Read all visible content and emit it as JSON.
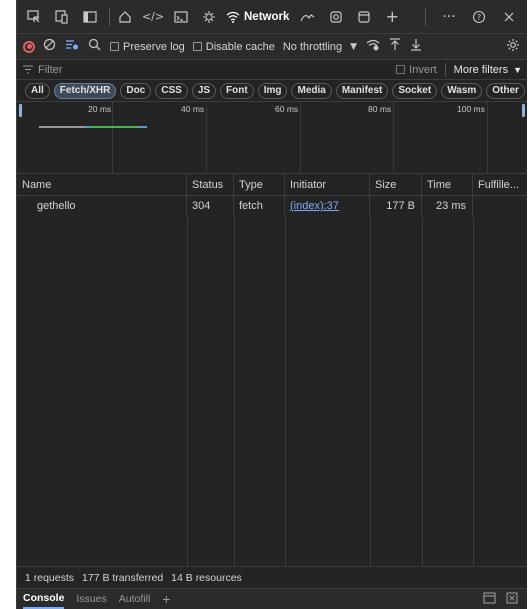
{
  "tabbar": {
    "icons": [
      "inspect-icon",
      "device-icon",
      "sidebar-icon",
      "home-icon",
      "elements-icon",
      "console-icon",
      "sources-icon"
    ],
    "active_tab": "Network",
    "icon_glyphs": {
      "inspect": "⬚",
      "device": "▭",
      "sidebar": "◧",
      "home": "⌂",
      "elements": "</>",
      "console": "⊡",
      "sources": "✲",
      "network": "≋",
      "performance": "↝",
      "memory": "⚙",
      "application": "▢",
      "more": "+",
      "overflow": "···",
      "help": "?",
      "close": "✕"
    }
  },
  "toolbar": {
    "preserve_log": "Preserve log",
    "disable_cache": "Disable cache",
    "throttling": "No throttling"
  },
  "filterbar": {
    "filter_placeholder": "Filter",
    "invert": "Invert",
    "more_filters": "More filters"
  },
  "chips": [
    "All",
    "Fetch/XHR",
    "Doc",
    "CSS",
    "JS",
    "Font",
    "Img",
    "Media",
    "Manifest",
    "Socket",
    "Wasm",
    "Other"
  ],
  "active_chip": "Fetch/XHR",
  "overview": {
    "ticks": [
      "20 ms",
      "40 ms",
      "60 ms",
      "80 ms",
      "100 ms"
    ]
  },
  "table": {
    "columns": [
      "Name",
      "Status",
      "Type",
      "Initiator",
      "Size",
      "Time",
      "Fulfille..."
    ],
    "rows": [
      {
        "name": "gethello",
        "status": "304",
        "type": "fetch",
        "initiator": "(index):37",
        "size": "177 B",
        "time": "23 ms",
        "fulfilled": ""
      }
    ]
  },
  "statusbar": {
    "requests": "1 requests",
    "transferred": "177 B transferred",
    "resources": "14 B resources"
  },
  "drawer": {
    "tabs": [
      "Console",
      "Issues",
      "Autofill"
    ],
    "active": "Console",
    "add": "+"
  }
}
